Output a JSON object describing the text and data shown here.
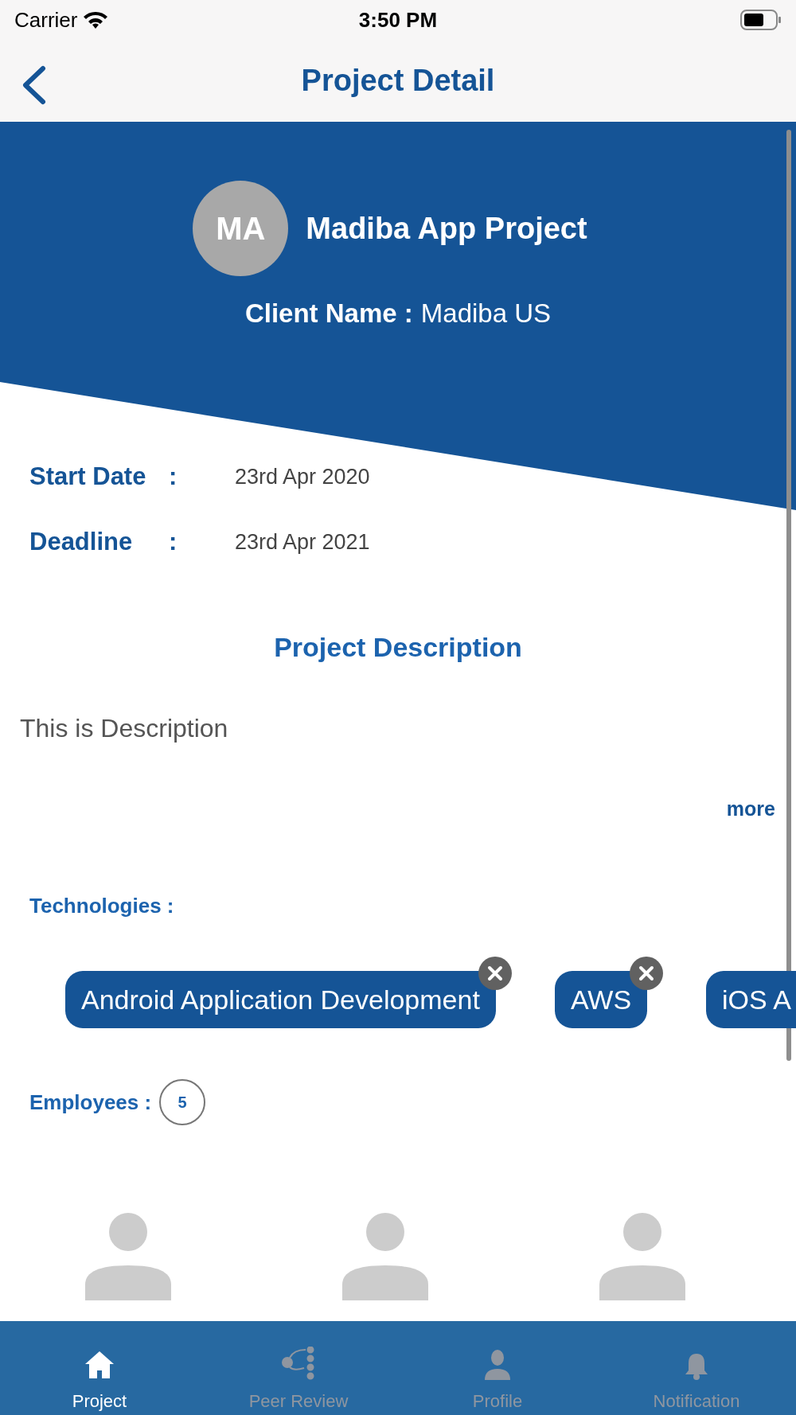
{
  "status_bar": {
    "carrier": "Carrier",
    "time": "3:50 PM"
  },
  "nav_bar": {
    "title": "Project Detail"
  },
  "project": {
    "initials": "MA",
    "name": "Madiba App Project",
    "client_label": "Client Name :",
    "client": "Madiba US"
  },
  "dates": [
    {
      "label": "Start Date",
      "separator": ":",
      "value": "23rd Apr 2020"
    },
    {
      "label": "Deadline",
      "separator": ":",
      "value": "23rd Apr 2021"
    }
  ],
  "description": {
    "heading": "Project Description",
    "text": "This is Description",
    "more": "more"
  },
  "technologies": {
    "label": "Technologies :",
    "chips": [
      {
        "label": "Android Application Development",
        "removable": true
      },
      {
        "label": "AWS",
        "removable": true
      },
      {
        "label": "iOS A",
        "removable": false
      }
    ]
  },
  "employees": {
    "label": "Employees :",
    "count": "5",
    "people": [
      {
        "kind": "avatar"
      },
      {
        "kind": "avatar"
      },
      {
        "kind": "avatar"
      }
    ]
  },
  "tab_bar": [
    {
      "label": "Project",
      "kind": "home",
      "selected": true
    },
    {
      "label": "Peer Review",
      "kind": "flow",
      "selected": false
    },
    {
      "label": "Profile",
      "kind": "person",
      "selected": false
    },
    {
      "label": "Notification",
      "kind": "bell",
      "selected": false
    }
  ]
}
